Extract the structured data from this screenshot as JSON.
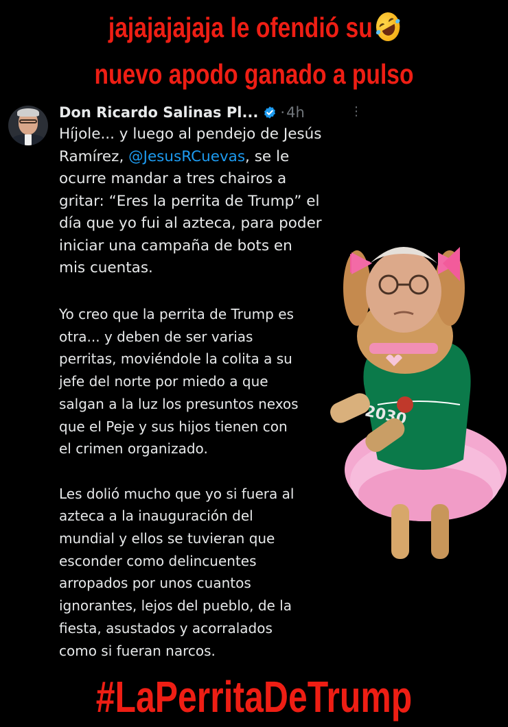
{
  "caption": {
    "line1": "jajajajajaja le ofendió su",
    "emoji": "rofl-emoji",
    "line2": "nuevo apodo ganado a pulso"
  },
  "tweet": {
    "display_name": "Don Ricardo Salinas Pl...",
    "verified": true,
    "separator": "·",
    "timestamp": "4h",
    "text_part1": "Híjole... y luego al pendejo de Jesús\nRamírez, ",
    "mention": "@JesusRCuevas",
    "text_part2": ", se le\nocurre mandar a tres chairos a\ngritar: “Eres la perrita de Trump” el\ndía que yo fui al azteca, para poder\niniciar una campaña de bots en\nmis cuentas.",
    "continuation": "Yo creo que la perrita de Trump es\notra... y deben de ser varias\nperritas, moviéndole la colita a su\njefe del norte por miedo a que\nsalgan a la luz los presuntos nexos\nque el Peje y sus hijos tienen con\nel crimen organizado.\n\nLes dolió mucho que yo si fuera al\nazteca a la inauguración del\nmundial y ellos se tuvieran que\nesconder como delincuentes\narropados por unos cuantos\nignorantes, lejos del pueblo, de la\nfiesta, asustados y acorralados\ncomo si fueran narcos."
  },
  "hashtag": "#LaPerritaDeTrump",
  "icons": {
    "verified": "verified-badge-icon",
    "more": "more-options-icon",
    "avatar": "profile-avatar"
  },
  "colors": {
    "caption_red": "#ee1e14",
    "mention_blue": "#1d9bf0",
    "verified_blue": "#1d9bf0",
    "muted_gray": "#71767b",
    "text": "#e7e9ea",
    "background": "#000000"
  }
}
